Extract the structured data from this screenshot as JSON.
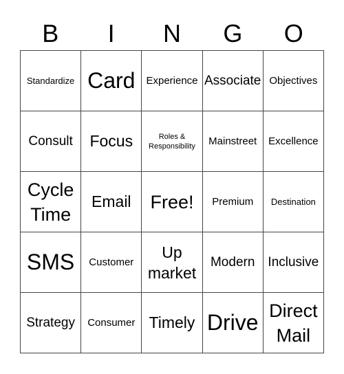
{
  "header": [
    "B",
    "I",
    "N",
    "G",
    "O"
  ],
  "cells": [
    [
      "Standardize",
      "Card",
      "Experience",
      "Associate",
      "Objectives"
    ],
    [
      "Consult",
      "Focus",
      "Roles & Responsibility",
      "Mainstreet",
      "Excellence"
    ],
    [
      "Cycle Time",
      "Email",
      "Free!",
      "Premium",
      "Destination"
    ],
    [
      "SMS",
      "Customer",
      "Up market",
      "Modern",
      "Inclusive"
    ],
    [
      "Strategy",
      "Consumer",
      "Timely",
      "Drive",
      "Direct Mail"
    ]
  ]
}
